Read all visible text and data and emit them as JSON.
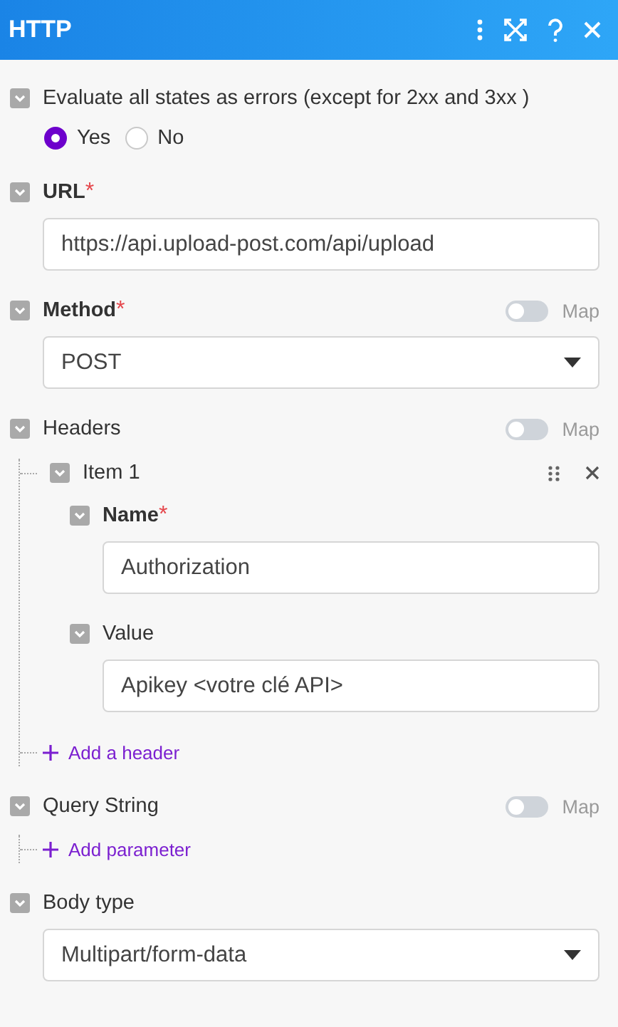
{
  "title": "HTTP",
  "sections": [
    {
      "kind": "radio",
      "label": "Evaluate all states as errors (except for 2xx and 3xx )",
      "options": [
        {
          "label": "Yes",
          "selected": true
        },
        {
          "label": "No",
          "selected": false
        }
      ]
    },
    {
      "kind": "text",
      "label": "URL",
      "required_mark": "*",
      "value": "https://api.upload-post.com/api/upload"
    },
    {
      "kind": "select",
      "label": "Method",
      "required_mark": "*",
      "map": {
        "label": "Map",
        "on": false
      },
      "value": "POST"
    },
    {
      "kind": "array",
      "label": "Headers",
      "map": {
        "label": "Map",
        "on": false
      },
      "items": [
        {
          "label": "Item 1",
          "fields": [
            {
              "kind": "text",
              "label": "Name",
              "required_mark": "*",
              "value": "Authorization"
            },
            {
              "kind": "text",
              "label": "Value",
              "value": "Apikey <votre clé API>"
            }
          ]
        }
      ],
      "add": "Add a header"
    },
    {
      "kind": "array",
      "label": "Query String",
      "map": {
        "label": "Map",
        "on": false
      },
      "add": "Add parameter"
    },
    {
      "kind": "select",
      "label": "Body type",
      "value": "Multipart/form-data"
    }
  ]
}
